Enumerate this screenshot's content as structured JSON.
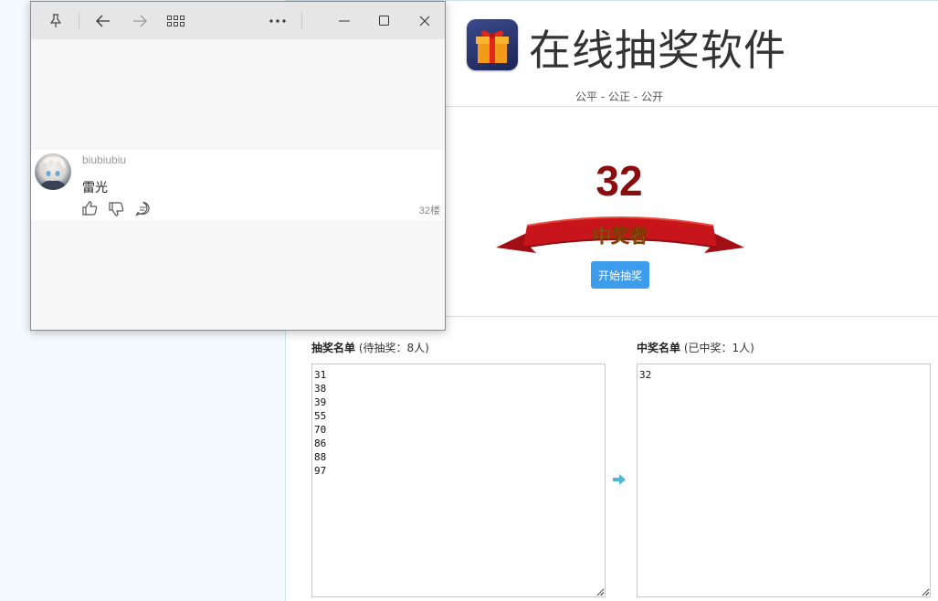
{
  "app": {
    "title": "在线抽奖软件",
    "subtitle": "公平 - 公正 - 公开"
  },
  "draw": {
    "winner_number": "32",
    "ribbon_text": "中奖者",
    "start_button_label": "开始抽奖"
  },
  "lists": {
    "pending": {
      "title": "抽奖名单",
      "count_text": "(待抽奖：8人)",
      "entries": [
        "31",
        "38",
        "39",
        "55",
        "70",
        "86",
        "88",
        "97"
      ]
    },
    "winners": {
      "title": "中奖名单",
      "count_text": "(已中奖：1人)",
      "entries": [
        "32"
      ]
    }
  },
  "popup": {
    "titlebar_icons": [
      "pin-icon",
      "back-icon",
      "forward-icon",
      "apps-grid-icon",
      "more-icon",
      "minimize-icon",
      "maximize-icon",
      "close-icon"
    ],
    "comment": {
      "username": "biubiubiu",
      "text": "雷光",
      "floor": "32楼"
    }
  },
  "colors": {
    "accent": "#3d9cec",
    "winner_number": "#8b0e0e",
    "ribbon": "#c8151b",
    "ribbon_text": "#ffd66a"
  }
}
